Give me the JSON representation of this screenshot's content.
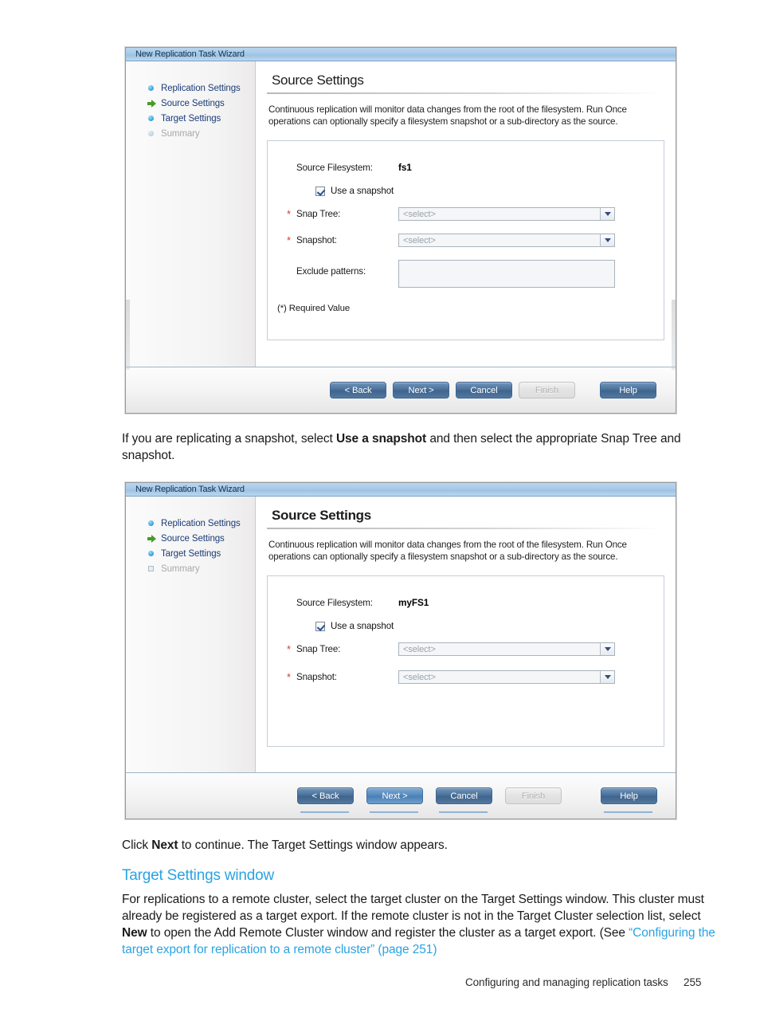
{
  "page": {
    "footer_text": "Configuring and managing replication tasks",
    "footer_page_number": "255"
  },
  "prose": {
    "para1_pre": "If you are replicating a snapshot, select ",
    "para1_bold": "Use a snapshot",
    "para1_post": " and then select the appropriate Snap Tree and snapshot.",
    "para2_pre": "Click ",
    "para2_bold": "Next",
    "para2_post": " to continue. The Target Settings window appears.",
    "section_heading": "Target Settings window",
    "para3_pre": "For replications to a remote cluster, select the target cluster on the Target Settings window. This cluster must already be registered as a target export. If the remote cluster is not in the Target Cluster selection list, select ",
    "para3_bold": "New",
    "para3_mid": " to open the Add Remote Cluster window and register the cluster as a target export. (See ",
    "para3_link": "“Configuring the target export for replication to a remote cluster”",
    "para3_page_ref": " (page 251)"
  },
  "colors": {
    "link": "#29a3e3",
    "heading": "#29a3e3",
    "step_label": "#1b3c78",
    "required_star": "#d03a3a",
    "titlebar": "#a9cbe9",
    "button_blue": "#4a7099",
    "button_primary": "#5388bd"
  },
  "dialog1": {
    "title": "New Replication Task Wizard",
    "steps": [
      {
        "label": "Replication Settings",
        "icon": "blue-dot-icon",
        "state": "done"
      },
      {
        "label": "Source Settings",
        "icon": "green-arrow-icon",
        "state": "current"
      },
      {
        "label": "Target Settings",
        "icon": "blue-dot-icon",
        "state": "pending"
      },
      {
        "label": "Summary",
        "icon": "grey-dot-icon",
        "state": "disabled"
      }
    ],
    "page_title": "Source Settings",
    "description": "Continuous replication will monitor data changes from the root of the filesystem. Run Once operations can optionally specify a filesystem snapshot or a sub-directory as the source.",
    "fields": {
      "source_filesystem_label": "Source Filesystem:",
      "source_filesystem_value": "fs1",
      "use_snapshot_label": "Use a snapshot",
      "use_snapshot_checked": true,
      "snap_tree_label": "Snap Tree:",
      "snap_tree_value": "<select>",
      "snapshot_label": "Snapshot:",
      "snapshot_value": "<select>",
      "exclude_patterns_label": "Exclude patterns:",
      "exclude_patterns_value": ""
    },
    "required_note": "(*) Required Value",
    "buttons": {
      "back": "< Back",
      "next": "Next >",
      "cancel": "Cancel",
      "finish": "Finish",
      "help": "Help"
    }
  },
  "dialog2": {
    "title": "New Replication Task Wizard",
    "steps": [
      {
        "label": "Replication Settings",
        "icon": "blue-dot-icon",
        "state": "done"
      },
      {
        "label": "Source Settings",
        "icon": "green-arrow-icon",
        "state": "current"
      },
      {
        "label": "Target Settings",
        "icon": "blue-dot-icon",
        "state": "pending"
      },
      {
        "label": "Summary",
        "icon": "grey-square-icon",
        "state": "disabled"
      }
    ],
    "page_title": "Source Settings",
    "description": "Continuous replication will monitor data changes from the root of the filesystem. Run Once operations can optionally specify a filesystem snapshot or a sub-directory as the source.",
    "fields": {
      "source_filesystem_label": "Source Filesystem:",
      "source_filesystem_value": "myFS1",
      "use_snapshot_label": "Use a snapshot",
      "use_snapshot_checked": true,
      "snap_tree_label": "Snap Tree:",
      "snap_tree_value": "<select>",
      "snapshot_label": "Snapshot:",
      "snapshot_value": "<select>"
    },
    "buttons": {
      "back": "< Back",
      "next": "Next >",
      "cancel": "Cancel",
      "finish": "Finish",
      "help": "Help"
    }
  }
}
